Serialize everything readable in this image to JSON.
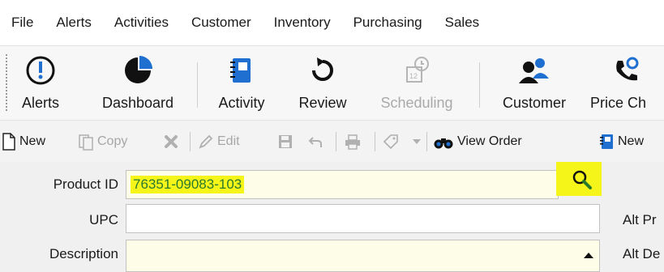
{
  "menu": [
    "File",
    "Alerts",
    "Activities",
    "Customer",
    "Inventory",
    "Purchasing",
    "Sales"
  ],
  "toolbar_big": {
    "alerts": "Alerts",
    "dashboard": "Dashboard",
    "activity": "Activity",
    "review": "Review",
    "scheduling": "Scheduling",
    "customer": "Customer",
    "price_check": "Price Ch"
  },
  "toolbar_small": {
    "new": "New",
    "copy": "Copy",
    "edit": "Edit",
    "view_order": "View Order",
    "new_partial": "New"
  },
  "form": {
    "product_id_label": "Product ID",
    "product_id_value": "76351-09083-103",
    "upc_label": "UPC",
    "description_label": "Description",
    "alt_pr_label": "Alt Pr",
    "alt_de_label": "Alt De"
  },
  "colors": {
    "highlight": "#f5f51a",
    "accent_blue": "#1e6fd0",
    "field_required_bg": "#fdfde8"
  }
}
